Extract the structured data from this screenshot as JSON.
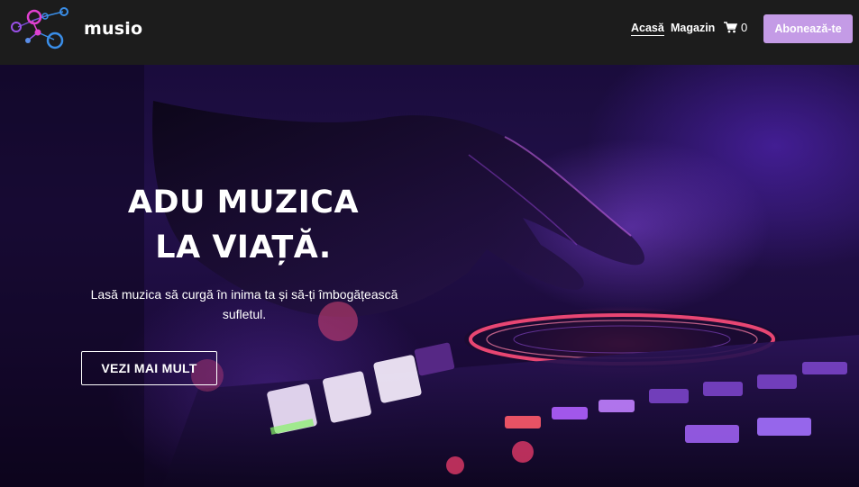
{
  "header": {
    "brand": "musio",
    "logo_icon": "molecule-logo-icon",
    "nav": [
      {
        "label": "Acasă",
        "active": true
      },
      {
        "label": "Magazin",
        "active": false
      }
    ],
    "cart": {
      "icon": "cart-icon",
      "count": "0"
    },
    "subscribe_label": "Abonează-te"
  },
  "hero": {
    "title_line1": "ADU MUZICA",
    "title_line2": "LA VIAȚĂ.",
    "subtitle": "Lasă muzica să curgă în inima ta și să-ți îmbogățească sufletul.",
    "cta_label": "VEZI MAI MULT"
  },
  "colors": {
    "header_bg": "#1c1c1c",
    "accent": "#c49be6",
    "logo_pink": "#e040d0",
    "logo_blue": "#3a8ee8",
    "logo_purple": "#9a50e8"
  }
}
